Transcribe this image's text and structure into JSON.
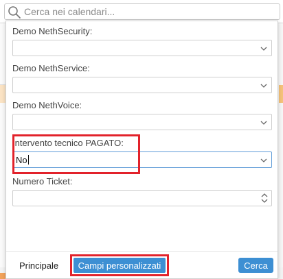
{
  "search": {
    "placeholder": "Cerca nei calendari..."
  },
  "fields": [
    {
      "label": "Demo NethSecurity:",
      "value": "",
      "control": "select"
    },
    {
      "label": "Demo NethService:",
      "value": "",
      "control": "select"
    },
    {
      "label": "Demo NethVoice:",
      "value": "",
      "control": "select"
    },
    {
      "label": "Intervento tecnico PAGATO:",
      "value": "No",
      "control": "select",
      "focused": true
    },
    {
      "label": "Numero Ticket:",
      "value": "",
      "control": "number"
    }
  ],
  "footer": {
    "tab_principale": "Principale",
    "tab_campi_personalizzati": "Campi personalizzati",
    "search_button": "Cerca"
  },
  "colors": {
    "accent": "#3d8fd3",
    "highlight": "#e2222b",
    "focus_border": "#5d9bd7"
  },
  "icons": {
    "search": "search-icon",
    "select": "chevron-down-icon",
    "number": "spinner-icon"
  }
}
